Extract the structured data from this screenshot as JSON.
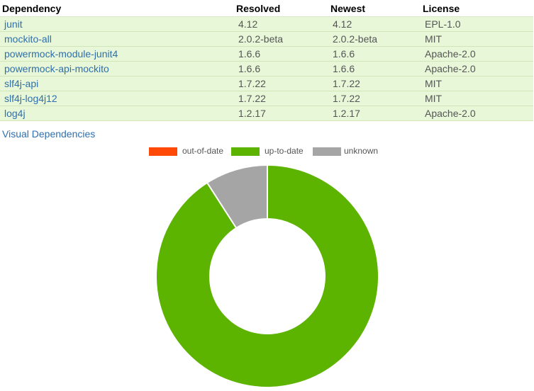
{
  "table": {
    "headers": [
      "Dependency",
      "Resolved",
      "Newest",
      "License"
    ],
    "rows": [
      [
        "junit",
        "4.12",
        "4.12",
        "EPL-1.0"
      ],
      [
        "mockito-all",
        "2.0.2-beta",
        "2.0.2-beta",
        "MIT"
      ],
      [
        "powermock-module-junit4",
        "1.6.6",
        "1.6.6",
        "Apache-2.0"
      ],
      [
        "powermock-api-mockito",
        "1.6.6",
        "1.6.6",
        "Apache-2.0"
      ],
      [
        "slf4j-api",
        "1.7.22",
        "1.7.22",
        "MIT"
      ],
      [
        "slf4j-log4j12",
        "1.7.22",
        "1.7.22",
        "MIT"
      ],
      [
        "log4j",
        "1.2.17",
        "1.2.17",
        "Apache-2.0"
      ]
    ]
  },
  "visual_link": "Visual Dependencies",
  "chart_data": {
    "type": "pie",
    "legend": [
      {
        "name": "out-of-date",
        "color": "#ff4a07"
      },
      {
        "name": "up-to-date",
        "color": "#5cb300"
      },
      {
        "name": "unknown",
        "color": "#a5a5a5"
      }
    ],
    "categories": [
      "out-of-date",
      "up-to-date",
      "unknown"
    ],
    "values": [
      0,
      10,
      1
    ],
    "colors": [
      "#ff4a07",
      "#5cb300",
      "#a5a5a5"
    ],
    "donut": true,
    "legend_position": "top-center"
  }
}
